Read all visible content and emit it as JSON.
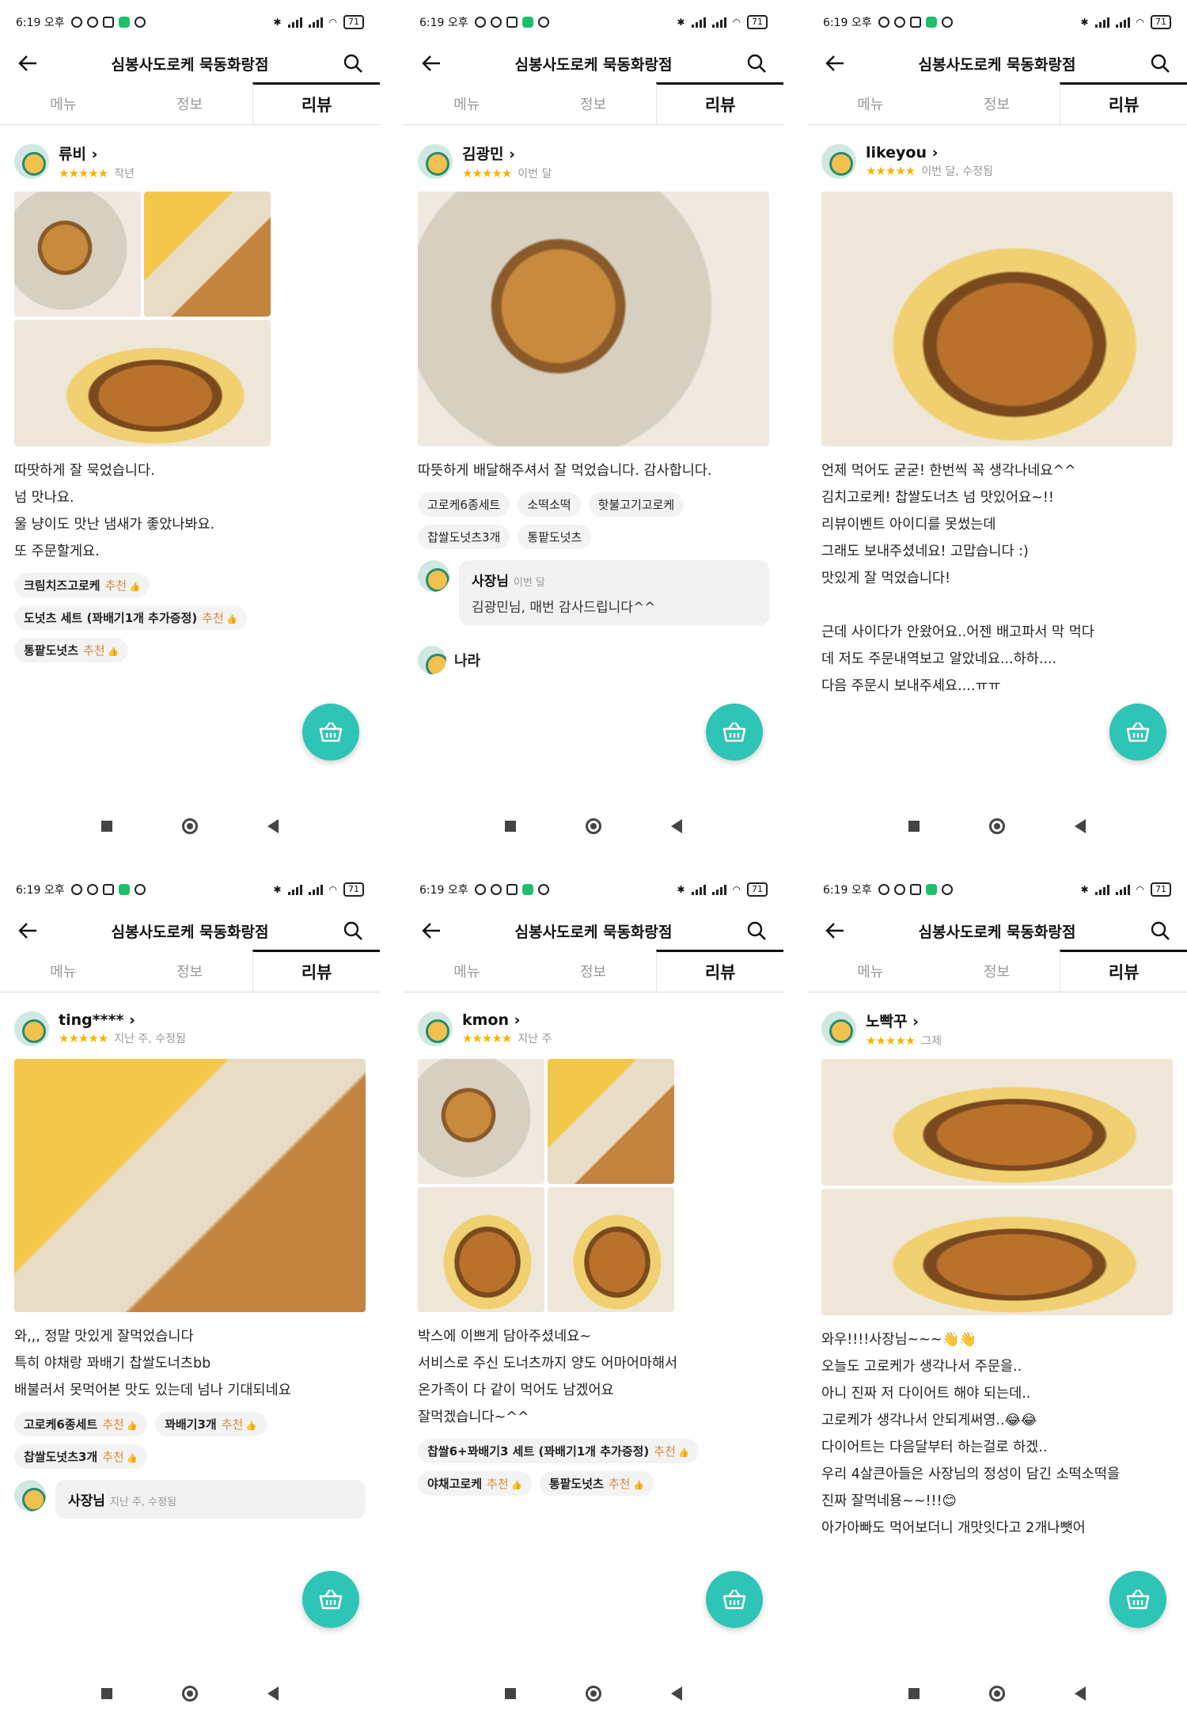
{
  "status": {
    "time": "6:19 오후",
    "battery": "71"
  },
  "header": {
    "title": "심봉사도로케 묵동화랑점"
  },
  "tabs": [
    "메뉴",
    "정보",
    "리뷰"
  ],
  "colors": {
    "accent": "#2ec4b6",
    "star": "#f5b400",
    "recommend": "#d98a3e"
  },
  "icons": {
    "back": "back-arrow-icon",
    "search": "search-icon",
    "cart": "shopping-basket-icon"
  },
  "screens": [
    {
      "reviewer": "류비",
      "stars": "★★★★★",
      "when": "작년",
      "text": [
        "따땃하게 잘 묵었습니다.",
        "넘 맛나요.",
        "울 냥이도 맛난 냄새가 좋았나봐요.",
        "또 주문할게요."
      ],
      "items": [
        "크림치즈고로케",
        "도넛츠 세트 (꽈배기1개 추가증정)",
        "통팥도넛츠"
      ],
      "recommend": "추천"
    },
    {
      "reviewer": "김광민",
      "stars": "★★★★★",
      "when": "이번 달",
      "text": [
        "따뜻하게 배달해주셔서 잘 먹었습니다. 감사합니다."
      ],
      "items": [
        "고로케6종세트",
        "소떡소떡",
        "핫불고기고로케",
        "찹쌀도넛츠3개",
        "통팥도넛츠"
      ],
      "reply": {
        "owner": "사장님",
        "when": "이번 달",
        "message": "김광민님, 매번 감사드립니다^^"
      },
      "next_reviewer": "나라"
    },
    {
      "reviewer": "likeyou",
      "stars": "★★★★★",
      "when": "이번 달, 수정됨",
      "text": [
        "언제 먹어도 굳굳! 한번씩 꼭 생각나네요^^",
        "김치고로케! 찹쌀도너츠 넘 맛있어요~!!",
        "리뷰이벤트 아이디를 못썼는데",
        "그래도 보내주셨네요! 고맙습니다 :)",
        "맛있게 잘 먹었습니다!",
        "",
        "근데 사이다가 안왔어요..어젠 배고파서 막 먹다",
        "데 저도 주문내역보고 알았네요...하하....",
        "다음 주문시 보내주세요....ㅠㅠ"
      ]
    },
    {
      "reviewer": "ting****",
      "stars": "★★★★★",
      "when": "지난 주, 수정됨",
      "text": [
        "와,,, 정말 맛있게 잘먹었습니다",
        "특히 야채랑 꽈배기 찹쌀도너츠bb",
        "배불러서 못먹어본 맛도 있는데 넘나 기대되네요"
      ],
      "items": [
        "고로케6종세트",
        "꽈배기3개",
        "찹쌀도넛츠3개"
      ],
      "reply": {
        "owner": "사장님",
        "when": "지난 주, 수정됨"
      }
    },
    {
      "reviewer": "kmon",
      "stars": "★★★★★",
      "when": "지난 주",
      "text": [
        "박스에 이쁘게 담아주셨네요~",
        "서비스로 주신 도너츠까지 양도 어마어마해서",
        "온가족이 다 같이 먹어도 남겠어요",
        "잘먹겠습니다~^^"
      ],
      "items": [
        "찹쌀6+꽈배기3 세트 (꽈배기1개 추가증정)",
        "야채고로케",
        "통팥도넛츠"
      ]
    },
    {
      "reviewer": "노빡꾸",
      "stars": "★★★★★",
      "when": "그제",
      "text": [
        "와우!!!!사장님~~~👋👋",
        "오늘도 고로케가 생각나서 주문을..",
        "아니 진짜 저 다이어트 해야 되는데..",
        "고로케가 생각나서 안되게써영..😂😂",
        "다이어트는 다음달부터 하는걸로 하겠..",
        "우리 4살큰아들은 사장님의 정성이 담긴 소떡소떡을",
        "진짜 잘먹네용~~!!!😊",
        "아가아빠도 먹어보더니 개맛잇다고 2개나뺏어"
      ]
    }
  ]
}
